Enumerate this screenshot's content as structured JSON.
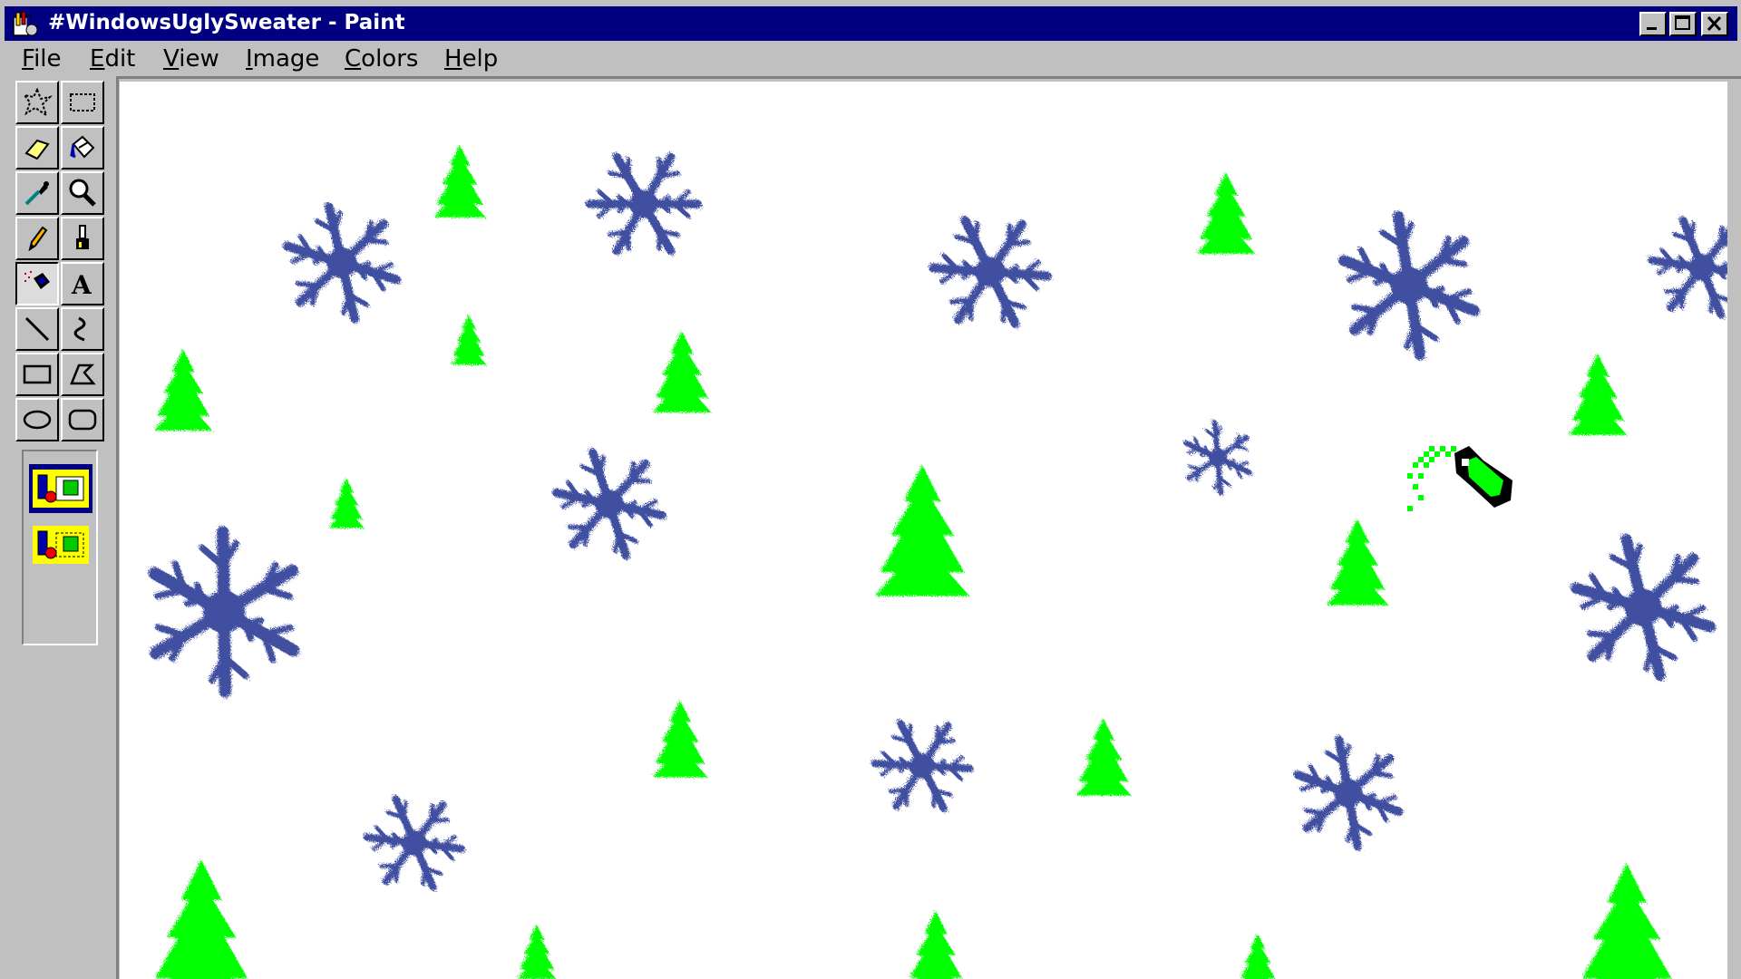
{
  "window": {
    "title": "#WindowsUglySweater - Paint",
    "app_icon": "paint-icon",
    "caption_buttons": [
      "minimize-icon",
      "maximize-icon",
      "close-icon"
    ]
  },
  "menu": {
    "items": [
      {
        "label": "File"
      },
      {
        "label": "Edit"
      },
      {
        "label": "View"
      },
      {
        "label": "Image"
      },
      {
        "label": "Colors"
      },
      {
        "label": "Help"
      }
    ]
  },
  "toolbox": {
    "tools": [
      {
        "icon": "free-form-select-icon"
      },
      {
        "icon": "rect-select-icon"
      },
      {
        "icon": "eraser-icon"
      },
      {
        "icon": "fill-bucket-icon"
      },
      {
        "icon": "color-picker-icon"
      },
      {
        "icon": "magnifier-icon"
      },
      {
        "icon": "pencil-icon"
      },
      {
        "icon": "brush-icon"
      },
      {
        "icon": "airbrush-icon",
        "selected": true
      },
      {
        "icon": "text-icon",
        "label": "A"
      },
      {
        "icon": "line-icon"
      },
      {
        "icon": "curve-icon"
      },
      {
        "icon": "rectangle-icon"
      },
      {
        "icon": "polygon-icon"
      },
      {
        "icon": "ellipse-icon"
      },
      {
        "icon": "rounded-rect-icon"
      }
    ],
    "options": [
      {
        "icon": "opaque-selection-icon",
        "selected": true
      },
      {
        "icon": "transparent-selection-icon",
        "selected": false
      }
    ]
  },
  "canvas": {
    "background": "#ffffff",
    "tree_color": "#00ff00",
    "snowflake_color": "#3f4fa0",
    "cursor_icon": "airbrush-cursor-icon"
  }
}
